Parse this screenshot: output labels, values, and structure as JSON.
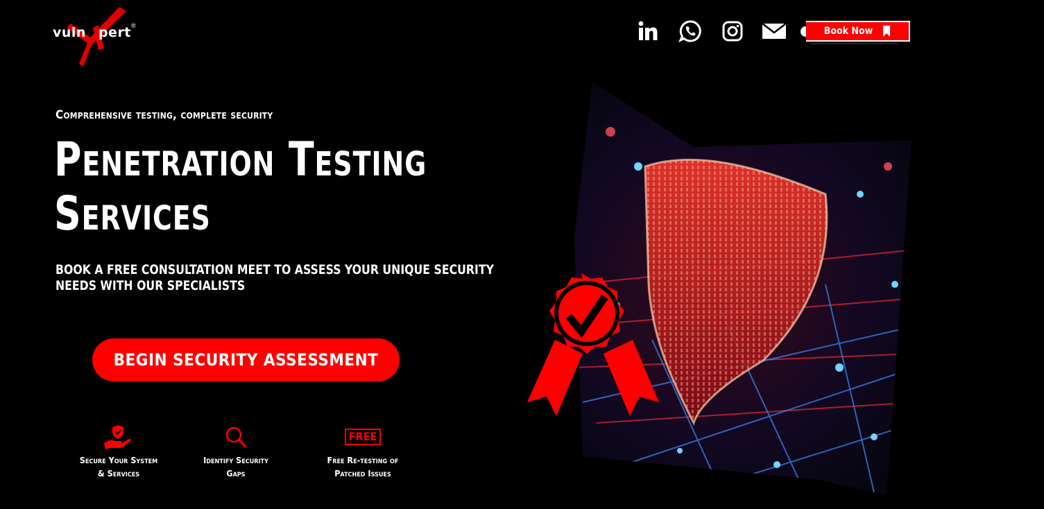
{
  "brand": {
    "logo_text": "vulnXpert",
    "accent": "#ff0000"
  },
  "header": {
    "social": [
      {
        "name": "linkedin-icon"
      },
      {
        "name": "whatsapp-icon"
      },
      {
        "name": "instagram-icon"
      },
      {
        "name": "mail-icon"
      }
    ],
    "book_now_label": "Book Now"
  },
  "hero": {
    "eyebrow": "Comprehensive testing, complete security",
    "title_line1": "Penetration Testing",
    "title_line2": "Services",
    "subtext": "Book a free consultation meet to assess your unique security needs with our specialists",
    "cta_label": "BEGIN SECURITY ASSESSMENT"
  },
  "features": [
    {
      "icon": "shield-hand-icon",
      "line1": "Secure Your System",
      "line2": "& Services"
    },
    {
      "icon": "search-icon",
      "line1": "Identify Security",
      "line2": "Gaps"
    },
    {
      "icon": "free-badge",
      "badge": "FREE",
      "line1": "Free Re-testing of",
      "line2": "Patched Issues"
    }
  ]
}
